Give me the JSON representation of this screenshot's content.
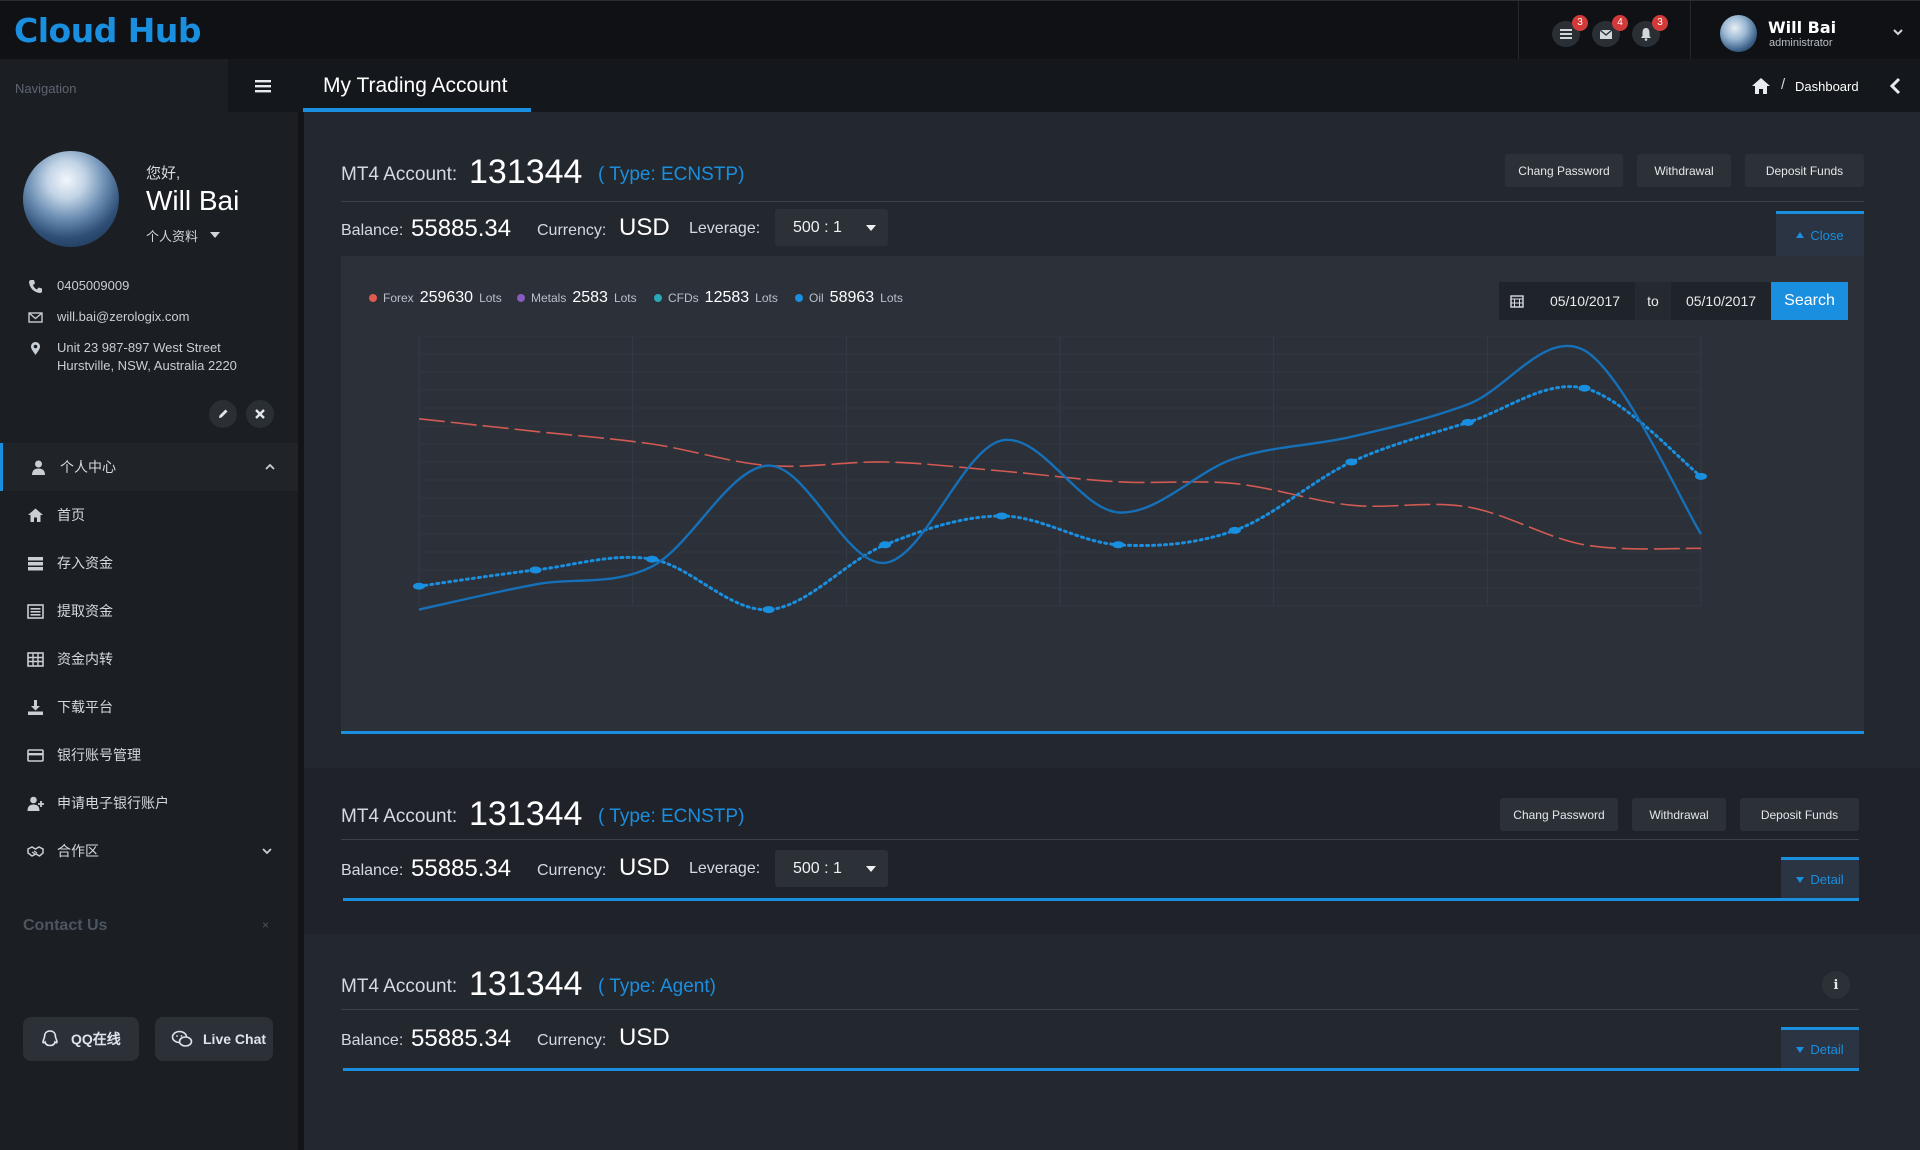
{
  "app": {
    "title": "Cloud Hub"
  },
  "topbar": {
    "badges": {
      "tasks": "3",
      "mail": "4",
      "alerts": "3"
    },
    "user": {
      "name": "Will Bai",
      "role": "administrator"
    }
  },
  "sidebar": {
    "nav_title": "Navigation",
    "profile": {
      "greeting": "您好,",
      "name": "Will Bai",
      "link": "个人资料",
      "phone": "0405009009",
      "email": "will.bai@zerologix.com",
      "address_line1": "Unit 23 987-897 West Street",
      "address_line2": "Hurstville, NSW, Australia 2220"
    },
    "menu": [
      {
        "label": "个人中心",
        "icon": "user-icon"
      },
      {
        "label": "首页",
        "icon": "home-icon"
      },
      {
        "label": "存入资金",
        "icon": "deposit-icon"
      },
      {
        "label": "提取资金",
        "icon": "withdraw-icon"
      },
      {
        "label": "资金内转",
        "icon": "grid-icon"
      },
      {
        "label": "下载平台",
        "icon": "download-icon"
      },
      {
        "label": "银行账号管理",
        "icon": "credit-card-icon"
      },
      {
        "label": "申请电子银行账户",
        "icon": "user-plus-icon"
      },
      {
        "label": "合作区",
        "icon": "handshake-icon"
      }
    ],
    "contact": {
      "title": "Contact Us",
      "close": "×",
      "qq_label": "QQ在线",
      "chat_label": "Live Chat"
    }
  },
  "header": {
    "title": "My Trading Account",
    "breadcrumb_current": "Dashboard",
    "breadcrumb_sep": "/"
  },
  "labels": {
    "mt4": "MT4 Account:",
    "balance": "Balance:",
    "currency": "Currency:",
    "leverage": "Leverage:",
    "change_password": "Chang Password",
    "withdrawal": "Withdrawal",
    "deposit": "Deposit Funds",
    "close": "Close",
    "detail": "Detail",
    "info": "i"
  },
  "accounts": [
    {
      "number": "131344",
      "type": "( Type: ECNSTP)",
      "balance": "55885.34",
      "currency": "USD",
      "leverage": "500 : 1"
    },
    {
      "number": "131344",
      "type": "( Type: ECNSTP)",
      "balance": "55885.34",
      "currency": "USD",
      "leverage": "500 : 1"
    },
    {
      "number": "131344",
      "type": "( Type: Agent)",
      "balance": "55885.34",
      "currency": "USD"
    }
  ],
  "chart_panel": {
    "legend": [
      {
        "name": "Forex",
        "value": "259630",
        "unit": "Lots",
        "color": "#e05a50"
      },
      {
        "name": "Metals",
        "value": "2583",
        "unit": "Lots",
        "color": "#8a5bbf"
      },
      {
        "name": "CFDs",
        "value": "12583",
        "unit": "Lots",
        "color": "#2aa8b8"
      },
      {
        "name": "Oil",
        "value": "58963",
        "unit": "Lots",
        "color": "#1a8fe0"
      }
    ],
    "date_from": "05/10/2017",
    "date_to_label": "to",
    "date_to": "05/10/2017",
    "search_label": "Search"
  },
  "chart_data": {
    "type": "line",
    "grid": true,
    "ylim": [
      0,
      15
    ],
    "x": [
      0,
      1,
      2,
      3,
      4,
      5,
      6,
      7,
      8,
      9,
      10,
      11
    ],
    "series": [
      {
        "color": "#d25a52",
        "style": "dashed",
        "values": [
          10.4,
          9.7,
          9.0,
          7.8,
          8.0,
          7.5,
          6.9,
          6.8,
          5.6,
          5.5,
          3.4,
          3.2
        ]
      },
      {
        "color": "#1a8fe0",
        "style": "dotted",
        "values": [
          1.1,
          2.0,
          2.6,
          -0.2,
          3.4,
          5.0,
          3.4,
          4.2,
          8.0,
          10.2,
          12.1,
          7.2
        ]
      },
      {
        "color": "#1670b8",
        "style": "solid",
        "values": [
          -0.2,
          1.2,
          2.2,
          7.8,
          2.4,
          9.2,
          5.2,
          8.2,
          9.4,
          11.2,
          14.2,
          4.0
        ]
      }
    ]
  },
  "colors": {
    "accent": "#1a8fe0",
    "badge": "#d23a3a",
    "background": "#23272e"
  }
}
